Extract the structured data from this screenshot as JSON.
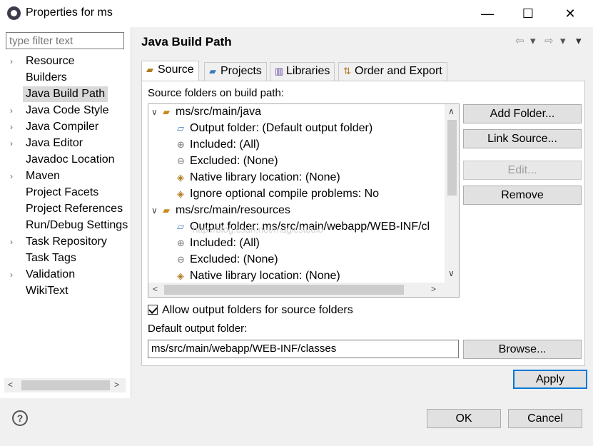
{
  "window": {
    "title": "Properties for ms",
    "minimize": "—",
    "maximize": "☐",
    "close": "✕"
  },
  "filter": {
    "placeholder": "type filter text"
  },
  "sidebar": {
    "items": [
      {
        "label": "Resource",
        "expandable": true
      },
      {
        "label": "Builders",
        "expandable": false
      },
      {
        "label": "Java Build Path",
        "expandable": false,
        "selected": true
      },
      {
        "label": "Java Code Style",
        "expandable": true
      },
      {
        "label": "Java Compiler",
        "expandable": true
      },
      {
        "label": "Java Editor",
        "expandable": true
      },
      {
        "label": "Javadoc Location",
        "expandable": false
      },
      {
        "label": "Maven",
        "expandable": true
      },
      {
        "label": "Project Facets",
        "expandable": false
      },
      {
        "label": "Project References",
        "expandable": false
      },
      {
        "label": "Run/Debug Settings",
        "expandable": false
      },
      {
        "label": "Task Repository",
        "expandable": true
      },
      {
        "label": "Task Tags",
        "expandable": false
      },
      {
        "label": "Validation",
        "expandable": true
      },
      {
        "label": "WikiText",
        "expandable": false
      }
    ]
  },
  "page": {
    "title": "Java Build Path",
    "back_arrow": "⇦",
    "forward_arrow": "⇨",
    "dropdown": "▾"
  },
  "tabs": [
    {
      "label": "Source",
      "icon": "source-folder-icon",
      "active": true
    },
    {
      "label": "Projects",
      "icon": "projects-icon"
    },
    {
      "label": "Libraries",
      "icon": "libraries-icon"
    },
    {
      "label": "Order and Export",
      "icon": "order-export-icon"
    }
  ],
  "source": {
    "label": "Source folders on build path:",
    "watermark": "http://blog.csdn.net/magicstudio",
    "tree": [
      {
        "label": "ms/src/main/java",
        "level": 0,
        "expanded": true,
        "icon": "package-folder-icon"
      },
      {
        "label": "Output folder: (Default output folder)",
        "level": 1,
        "icon": "output-folder-icon"
      },
      {
        "label": "Included: (All)",
        "level": 1,
        "icon": "include-filter-icon"
      },
      {
        "label": "Excluded: (None)",
        "level": 1,
        "icon": "exclude-filter-icon"
      },
      {
        "label": "Native library location: (None)",
        "level": 1,
        "icon": "native-library-icon"
      },
      {
        "label": "Ignore optional compile problems: No",
        "level": 1,
        "icon": "ignore-problems-icon"
      },
      {
        "label": "ms/src/main/resources",
        "level": 0,
        "expanded": true,
        "icon": "package-folder-icon"
      },
      {
        "label": "Output folder: ms/src/main/webapp/WEB-INF/cl",
        "level": 1,
        "icon": "output-folder-icon"
      },
      {
        "label": "Included: (All)",
        "level": 1,
        "icon": "include-filter-icon"
      },
      {
        "label": "Excluded: (None)",
        "level": 1,
        "icon": "exclude-filter-icon"
      },
      {
        "label": "Native library location: (None)",
        "level": 1,
        "icon": "native-library-icon"
      }
    ]
  },
  "buttons": {
    "add_folder": "Add Folder...",
    "link_source": "Link Source...",
    "edit": "Edit...",
    "remove": "Remove",
    "browse": "Browse...",
    "apply": "Apply",
    "ok": "OK",
    "cancel": "Cancel"
  },
  "options": {
    "allow_output_folders": "Allow output folders for source folders",
    "allow_output_checked": true,
    "default_output_label": "Default output folder:",
    "default_output_value": "ms/src/main/webapp/WEB-INF/classes"
  },
  "help": {
    "icon_glyph": "?"
  },
  "colors": {
    "accent": "#0078d7",
    "selection": "#d9d9d9"
  }
}
